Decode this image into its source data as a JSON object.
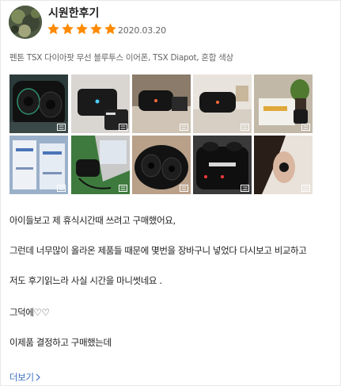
{
  "review": {
    "username": "시원한후기",
    "rating": 5,
    "max_rating": 5,
    "date": "2020.03.20",
    "product": "펜톤 TSX 다이아팟 무선 블루투스 이어폰, TSX Diapot, 혼합 색상",
    "photos": [
      {
        "name": "photo-black-earbuds-case-open",
        "icon": "zoom-icon"
      },
      {
        "name": "photo-case-with-led",
        "icon": "zoom-icon"
      },
      {
        "name": "photo-case-on-desk",
        "icon": "zoom-icon"
      },
      {
        "name": "photo-case-on-table",
        "icon": "zoom-icon"
      },
      {
        "name": "photo-box-with-plant",
        "icon": "zoom-icon"
      },
      {
        "name": "photo-boxes-stack",
        "icon": "zoom-icon"
      },
      {
        "name": "photo-case-near-laptop",
        "icon": "zoom-icon"
      },
      {
        "name": "photo-earbuds-in-hand",
        "icon": "zoom-icon"
      },
      {
        "name": "photo-pentone-case-led",
        "icon": "zoom-icon"
      },
      {
        "name": "photo-earbud-worn",
        "icon": "zoom-icon"
      }
    ],
    "body_lines": [
      "아이들보고 제 휴식시간때 쓰려고 구매했어요,",
      "그런데 너무많이 올라온 제품들 때문에 몇번을 장바구니 넣었다 다시보고 비교하고",
      "저도 후기읽느라 사실 시간을 마니썻네요 .",
      "그덕에♡♡",
      "이제품 결정하고 구매했는데"
    ],
    "more_label": "더보기",
    "more_icon": "chevron-right-icon"
  },
  "colors": {
    "star": "#ff8a00",
    "link": "#3a6fc4",
    "meta": "#666666"
  }
}
